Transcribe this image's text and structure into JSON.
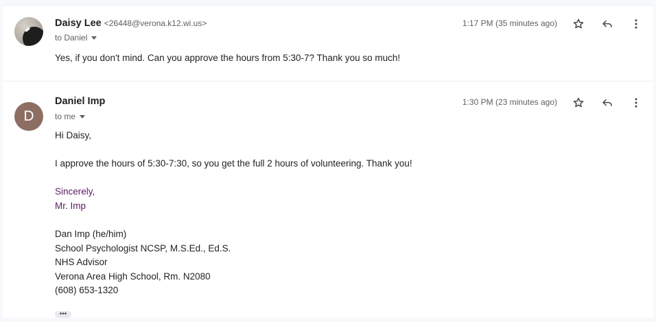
{
  "messages": [
    {
      "sender_name": "Daisy Lee",
      "sender_email": "<26448@verona.k12.wi.us>",
      "recipient": "to Daniel",
      "timestamp": "1:17 PM (35 minutes ago)",
      "body": "Yes, if you don't mind. Can you approve the hours from 5:30-7? Thank you so much!"
    },
    {
      "sender_name": "Daniel Imp",
      "avatar_letter": "D",
      "avatar_color": "#8d6e63",
      "recipient": "to me",
      "timestamp": "1:30 PM (23 minutes ago)",
      "greeting": "Hi Daisy,",
      "body": "I approve the hours of 5:30-7:30, so you get the full 2 hours of volunteering. Thank you!",
      "closing": "Sincerely,",
      "closing_name": "Mr. Imp",
      "signature": [
        "Dan Imp (he/him)",
        "School Psychologist NCSP, M.S.Ed., Ed.S.",
        "NHS Advisor",
        "Verona Area High School, Rm. N2080",
        "(608) 653-1320"
      ],
      "trimmed_content_label": "•••"
    }
  ],
  "icons": {
    "star": "star-icon",
    "reply": "reply-icon",
    "more": "more-vert-icon",
    "caret": "chevron-down-icon"
  },
  "colors": {
    "signature_purple": "#5b1a63",
    "background": "#f6f8fc"
  }
}
